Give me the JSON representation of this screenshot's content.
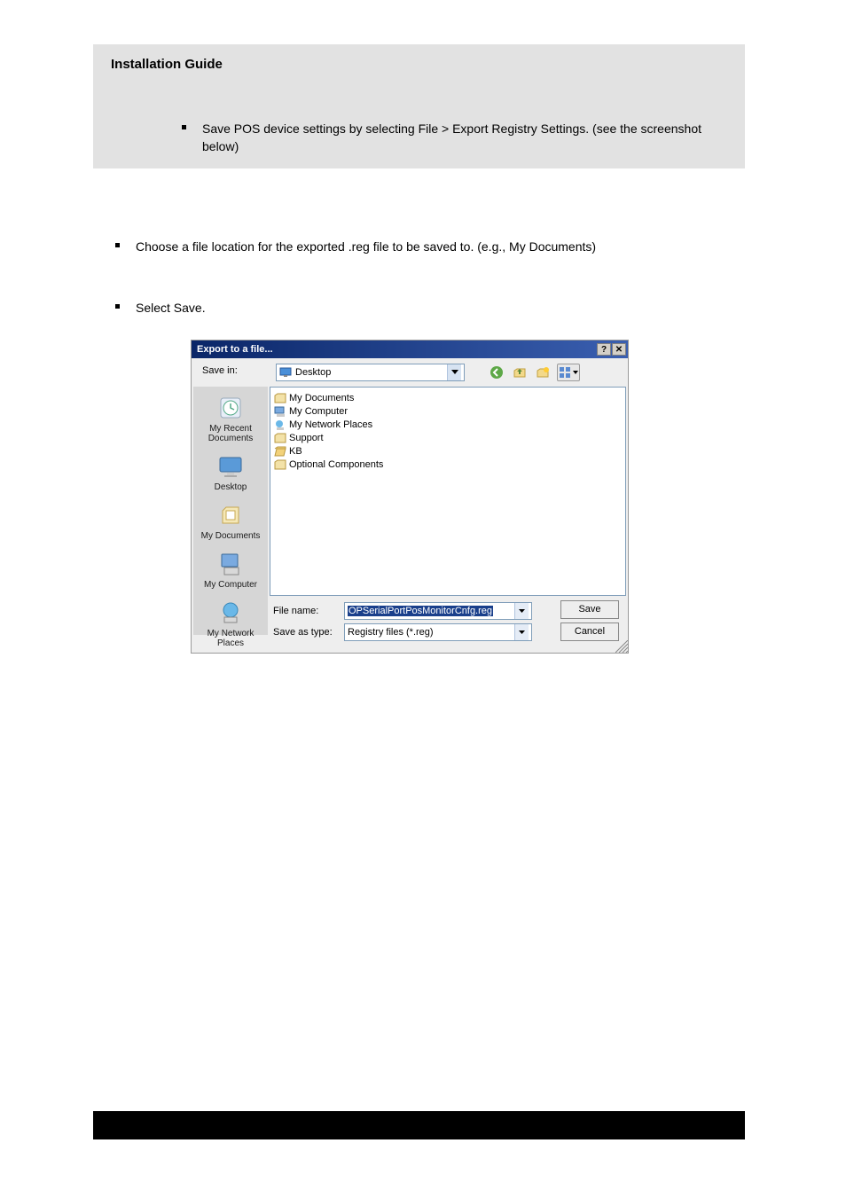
{
  "header": {
    "title": "Installation Guide",
    "bullet1": "Save POS device settings by selecting File > Export Registry Settings. (see the screenshot below)"
  },
  "body": {
    "bullet2": "Choose a file location for the exported .reg file to be saved to. (e.g., My Documents)",
    "bullet3": "Select Save."
  },
  "dialog": {
    "title": "Export to a file...",
    "helpGlyph": "?",
    "closeGlyph": "✕",
    "saveInLabel": "Save in:",
    "saveInValue": "Desktop",
    "toolbarIcons": {
      "back": "back-icon",
      "up": "up-icon",
      "newFolder": "new-folder-icon",
      "views": "views-icon"
    },
    "sidebar": [
      {
        "label": "My Recent Documents"
      },
      {
        "label": "Desktop"
      },
      {
        "label": "My Documents"
      },
      {
        "label": "My Computer"
      },
      {
        "label": "My Network Places"
      }
    ],
    "files": [
      {
        "name": "My Documents",
        "type": "folder-special"
      },
      {
        "name": "My Computer",
        "type": "computer"
      },
      {
        "name": "My Network Places",
        "type": "network"
      },
      {
        "name": "Support",
        "type": "folder"
      },
      {
        "name": "KB",
        "type": "folder-open"
      },
      {
        "name": "Optional Components",
        "type": "folder"
      }
    ],
    "fileNameLabel": "File name:",
    "fileNameValue": "OPSerialPortPosMonitorCnfg.reg",
    "saveAsTypeLabel": "Save as type:",
    "saveAsTypeValue": "Registry files (*.reg)",
    "saveButton": "Save",
    "cancelButton": "Cancel"
  },
  "colors": {
    "headerGray": "#e2e2e2",
    "dialogBg": "#eeeeee",
    "titlebarStart": "#0a2668",
    "titlebarEnd": "#3a5fb0",
    "selection": "#1a3f8b"
  }
}
